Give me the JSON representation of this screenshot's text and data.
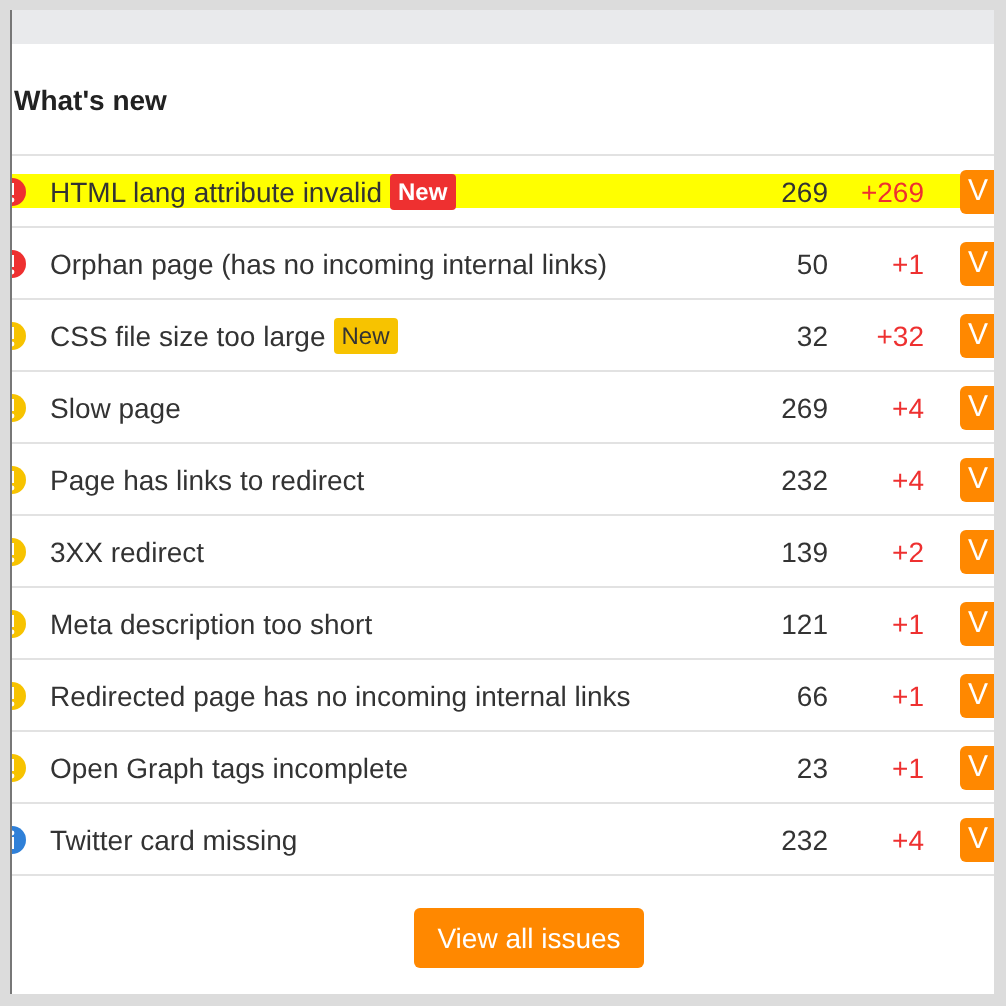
{
  "title": "What's new",
  "issues": [
    {
      "kind": "error",
      "label": "HTML lang attribute invalid",
      "badge": "New",
      "count": "269",
      "change": "+269",
      "highlighted": true,
      "action": "V"
    },
    {
      "kind": "error",
      "label": "Orphan page (has no incoming internal links)",
      "count": "50",
      "change": "+1",
      "highlighted": false,
      "action": "V"
    },
    {
      "kind": "warning",
      "label": "CSS file size too large",
      "badge": "New",
      "count": "32",
      "change": "+32",
      "highlighted": false,
      "action": "V"
    },
    {
      "kind": "warning",
      "label": "Slow page",
      "count": "269",
      "change": "+4",
      "highlighted": false,
      "action": "V"
    },
    {
      "kind": "warning",
      "label": "Page has links to redirect",
      "count": "232",
      "change": "+4",
      "highlighted": false,
      "action": "V"
    },
    {
      "kind": "warning",
      "label": "3XX redirect",
      "count": "139",
      "change": "+2",
      "highlighted": false,
      "action": "V"
    },
    {
      "kind": "warning",
      "label": "Meta description too short",
      "count": "121",
      "change": "+1",
      "highlighted": false,
      "action": "V"
    },
    {
      "kind": "warning",
      "label": "Redirected page has no incoming internal links",
      "count": "66",
      "change": "+1",
      "highlighted": false,
      "action": "V"
    },
    {
      "kind": "warning",
      "label": "Open Graph tags incomplete",
      "count": "23",
      "change": "+1",
      "highlighted": false,
      "action": "V"
    },
    {
      "kind": "notice",
      "label": "Twitter card missing",
      "count": "232",
      "change": "+4",
      "highlighted": false,
      "action": "V"
    }
  ],
  "footer_button": "View all issues"
}
